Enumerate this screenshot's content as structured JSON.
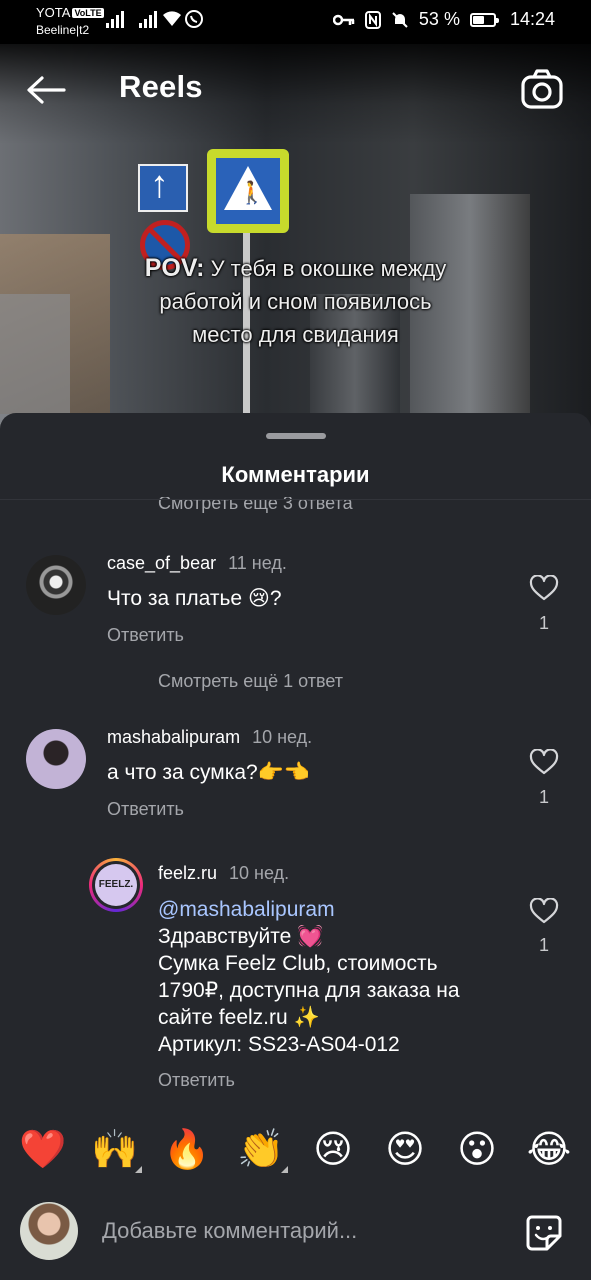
{
  "status_bar": {
    "carrier1": "YOTA",
    "carrier1_badge": "VoLTE",
    "carrier2": "Beeline|t2",
    "battery_percent": "53 %",
    "battery_level": 0.53,
    "time": "14:24"
  },
  "header": {
    "title": "Reels",
    "caption_prefix": "POV:",
    "caption_line1": " У тебя в окошке между",
    "caption_line2": "работой и сном появилось",
    "caption_line3": "место для свидания"
  },
  "sheet": {
    "title": "Комментарии",
    "cutoff_more": "Смотреть еще 3 ответа",
    "comments": [
      {
        "username": "case_of_bear",
        "time": "11 нед.",
        "text": "Что за платье 😢?",
        "reply": "Ответить",
        "likes": "1"
      },
      {
        "username": "mashabalipuram",
        "time": "10 нед.",
        "text": "а что за сумка?👉👈",
        "reply": "Ответить",
        "likes": "1"
      }
    ],
    "see_more_1": "Смотреть ещё 1 ответ",
    "reply_comment": {
      "username": "feelz.ru",
      "avatar_text": "FEELZ.",
      "time": "10 нед.",
      "mention": "@mashabalipuram",
      "line1": "Здравствуйте 💓",
      "line2": "Сумка Feelz Club, стоимость",
      "line3": "1790₽, доступна для заказа на",
      "line4": "сайте feelz.ru ✨",
      "line5": "Артикул: SS23-AS04-012",
      "reply": "Ответить",
      "likes": "1"
    },
    "emojis": [
      "❤️",
      "🙌",
      "🔥",
      "👏",
      "😢",
      "😍",
      "😮",
      "😂"
    ],
    "input_placeholder": "Добавьте комментарий..."
  },
  "icons": {
    "back": "back-arrow-icon",
    "camera": "camera-icon",
    "heart": "heart-outline-icon",
    "sticker": "sticker-icon"
  },
  "colors": {
    "sheet_bg": "#25272c",
    "muted_text": "#a4a6ab",
    "mention": "#a9c6ff"
  }
}
